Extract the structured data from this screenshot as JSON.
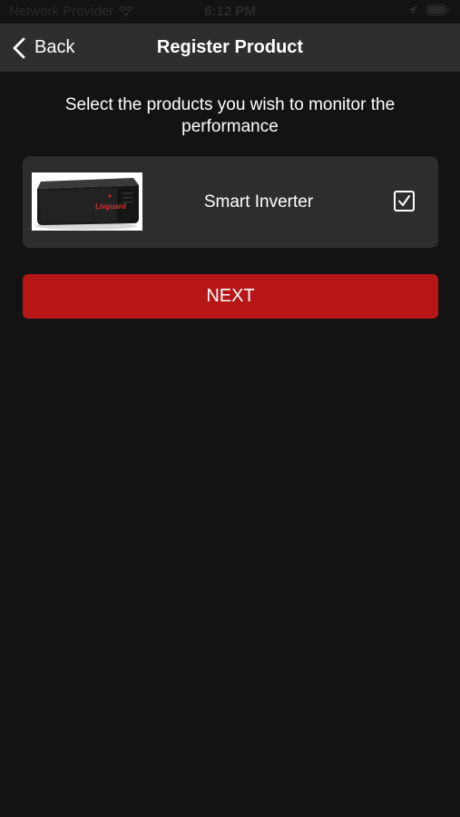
{
  "status_bar": {
    "carrier": "Network Provider",
    "time": "6:12 PM",
    "icons": [
      "wifi-icon",
      "location-icon",
      "battery-icon"
    ]
  },
  "nav": {
    "back_label": "Back",
    "title": "Register Product"
  },
  "instruction": "Select the products you wish to monitor the performance",
  "products": [
    {
      "name": "Smart Inverter",
      "brand": "Livguard",
      "checked": true
    }
  ],
  "next_label": "NEXT",
  "colors": {
    "background": "#131313",
    "nav_bar": "#2e2e2e",
    "card": "#2d2d2d",
    "accent": "#b71616",
    "text": "#ffffff"
  }
}
